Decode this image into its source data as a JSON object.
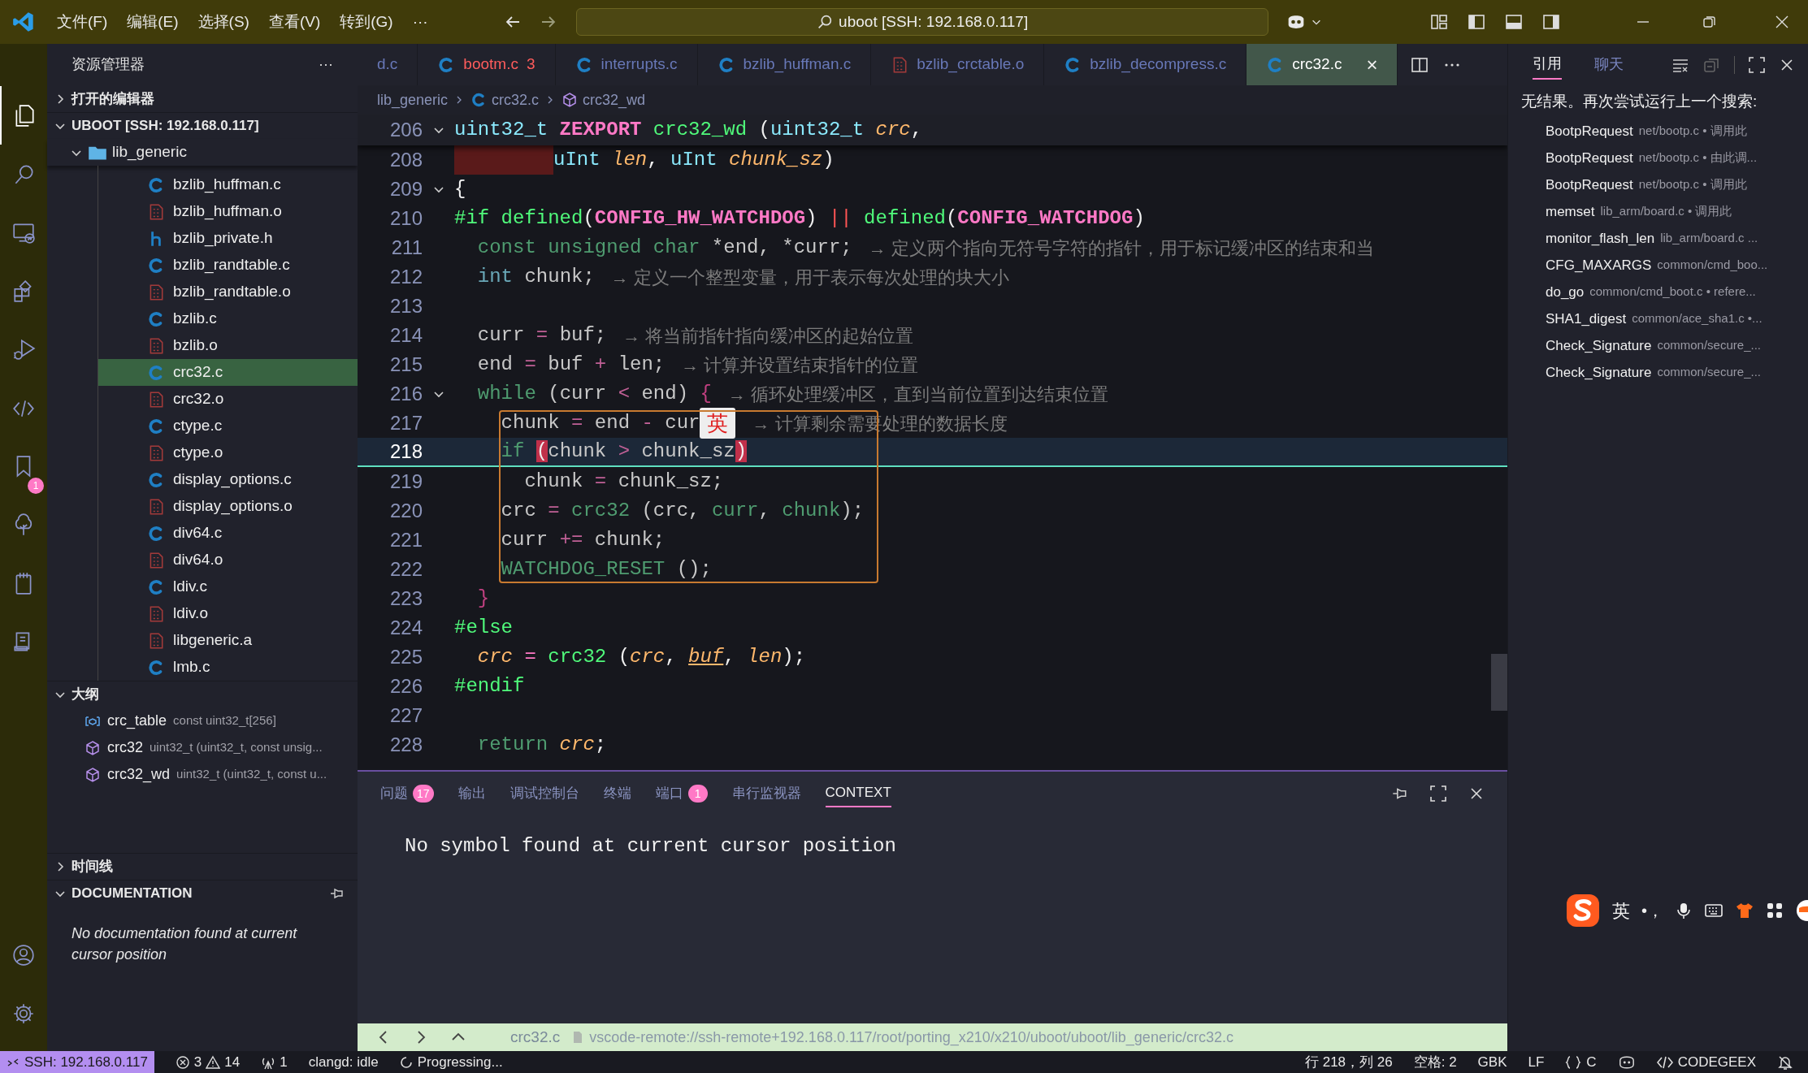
{
  "title_bar": {
    "menus": [
      "文件(F)",
      "编辑(E)",
      "选择(S)",
      "查看(V)",
      "转到(G)",
      "···"
    ],
    "search": "uboot [SSH: 192.168.0.117]"
  },
  "activity_bar": {
    "top": [
      {
        "kind": "files",
        "selected": true
      },
      {
        "kind": "search",
        "selected": false
      },
      {
        "kind": "remote",
        "selected": false
      },
      {
        "kind": "extensions",
        "selected": false
      },
      {
        "kind": "debug",
        "selected": false
      },
      {
        "kind": "code",
        "selected": false
      },
      {
        "kind": "bookmark",
        "selected": false,
        "badge": "1"
      },
      {
        "kind": "tree",
        "selected": false
      },
      {
        "kind": "notebook",
        "selected": false
      },
      {
        "kind": "document",
        "selected": false
      }
    ],
    "bottom": [
      {
        "kind": "account",
        "selected": false
      },
      {
        "kind": "gear",
        "selected": false
      }
    ]
  },
  "sidebar": {
    "title": "资源管理器",
    "more": "···",
    "open_editors": {
      "label": "打开的编辑器",
      "expanded": false
    },
    "workspace": {
      "label": "UBOOT [SSH: 192.168.0.117]",
      "expanded": true,
      "tree": [
        {
          "label": "lib_generic",
          "kind": "folder",
          "expanded": true,
          "children": [
            {
              "label": "bzlib_huffman.c",
              "kind": "c",
              "selected": false
            },
            {
              "label": "bzlib_huffman.o",
              "kind": "o",
              "selected": false
            },
            {
              "label": "bzlib_private.h",
              "kind": "h",
              "selected": false
            },
            {
              "label": "bzlib_randtable.c",
              "kind": "c",
              "selected": false
            },
            {
              "label": "bzlib_randtable.o",
              "kind": "o",
              "selected": false
            },
            {
              "label": "bzlib.c",
              "kind": "c",
              "selected": false
            },
            {
              "label": "bzlib.o",
              "kind": "o",
              "selected": false
            },
            {
              "label": "crc32.c",
              "kind": "c",
              "selected": true
            },
            {
              "label": "crc32.o",
              "kind": "o",
              "selected": false
            },
            {
              "label": "ctype.c",
              "kind": "c",
              "selected": false
            },
            {
              "label": "ctype.o",
              "kind": "o",
              "selected": false
            },
            {
              "label": "display_options.c",
              "kind": "c",
              "selected": false
            },
            {
              "label": "display_options.o",
              "kind": "o",
              "selected": false
            },
            {
              "label": "div64.c",
              "kind": "c",
              "selected": false
            },
            {
              "label": "div64.o",
              "kind": "o",
              "selected": false
            },
            {
              "label": "ldiv.c",
              "kind": "c",
              "selected": false
            },
            {
              "label": "ldiv.o",
              "kind": "o",
              "selected": false
            },
            {
              "label": "libgeneric.a",
              "kind": "o",
              "selected": false
            },
            {
              "label": "lmb.c",
              "kind": "c",
              "selected": false
            }
          ]
        }
      ]
    },
    "outline": {
      "label": "大纲",
      "expanded": true,
      "items": [
        {
          "name": "crc_table",
          "detail": "const uint32_t[256]",
          "kind": "variable"
        },
        {
          "name": "crc32",
          "detail": "uint32_t (uint32_t, const unsig...",
          "kind": "function"
        },
        {
          "name": "crc32_wd",
          "detail": "uint32_t (uint32_t, const u...",
          "kind": "function"
        }
      ]
    },
    "timeline": {
      "label": "时间线",
      "expanded": false
    },
    "documentation": {
      "label": "DOCUMENTATION",
      "expanded": true,
      "text": "No documentation found at current cursor position"
    }
  },
  "tabs": [
    {
      "label": "d.c",
      "kind": "none",
      "error": false,
      "selected": false
    },
    {
      "label": "bootm.c",
      "kind": "c",
      "error": true,
      "problems": "3",
      "selected": false
    },
    {
      "label": "interrupts.c",
      "kind": "c",
      "error": false,
      "selected": false
    },
    {
      "label": "bzlib_huffman.c",
      "kind": "c",
      "error": false,
      "selected": false
    },
    {
      "label": "bzlib_crctable.o",
      "kind": "o",
      "error": false,
      "selected": false
    },
    {
      "label": "bzlib_decompress.c",
      "kind": "c",
      "error": false,
      "selected": false
    },
    {
      "label": "crc32.c",
      "kind": "c",
      "error": false,
      "selected": true,
      "close": "×"
    }
  ],
  "editor": {
    "breadcrumb": [
      {
        "label": "lib_generic"
      },
      {
        "label": "crc32.c",
        "kind": "c"
      },
      {
        "label": "crc32_wd",
        "kind": "function"
      }
    ],
    "sticky": {
      "number": "206",
      "fold": true,
      "current": false,
      "error_indent": false,
      "tokens": [
        {
          "text": "uint32_t",
          "kind": "type"
        },
        {
          "text": " ZEXPORT",
          "kind": "macro"
        },
        {
          "text": " crc32_wd",
          "kind": "func"
        },
        {
          "text": " (",
          "kind": "plain"
        },
        {
          "text": "uint32_t",
          "kind": "type"
        },
        {
          "text": " crc",
          "kind": "param"
        },
        {
          "text": ",",
          "kind": "plain"
        }
      ]
    },
    "lines": [
      {
        "number": "208",
        "fold": false,
        "current": false,
        "error_indent": true,
        "tokens": [
          {
            "text": "uInt",
            "kind": "type"
          },
          {
            "text": " len",
            "kind": "param"
          },
          {
            "text": ",",
            "kind": "plain"
          },
          {
            "text": " uInt",
            "kind": "type"
          },
          {
            "text": " chunk_sz",
            "kind": "param"
          },
          {
            "text": ")",
            "kind": "plain"
          }
        ]
      },
      {
        "number": "209",
        "fold": true,
        "current": false,
        "error_indent": false,
        "tokens": [
          {
            "text": "{",
            "kind": "plain"
          }
        ]
      },
      {
        "number": "210",
        "fold": false,
        "current": false,
        "error_indent": false,
        "tokens": [
          {
            "text": "#if defined",
            "kind": "preproc"
          },
          {
            "text": "(",
            "kind": "plain"
          },
          {
            "text": "CONFIG_HW_WATCHDOG",
            "kind": "macro"
          },
          {
            "text": ") ",
            "kind": "plain"
          },
          {
            "text": "||",
            "kind": "op"
          },
          {
            "text": " defined",
            "kind": "preproc"
          },
          {
            "text": "(",
            "kind": "plain"
          },
          {
            "text": "CONFIG_WATCHDOG",
            "kind": "macro"
          },
          {
            "text": ")",
            "kind": "plain"
          }
        ]
      },
      {
        "number": "211",
        "fold": false,
        "current": false,
        "error_indent": false,
        "tokens": [
          {
            "text": "  const unsigned char",
            "kind": "kw"
          },
          {
            "text": " *end, *curr;",
            "kind": "dim"
          }
        ],
        "hint": "→ 定义两个指向无符号字符的指针，用于标记缓冲区的结束和当"
      },
      {
        "number": "212",
        "fold": false,
        "current": false,
        "error_indent": false,
        "tokens": [
          {
            "text": "  int",
            "kind": "dimtype"
          },
          {
            "text": " chunk;",
            "kind": "dim"
          }
        ],
        "hint": "→ 定义一个整型变量，用于表示每次处理的块大小"
      },
      {
        "number": "213",
        "fold": false,
        "current": false,
        "error_indent": false
      },
      {
        "number": "214",
        "fold": false,
        "current": false,
        "error_indent": false,
        "tokens": [
          {
            "text": "  curr ",
            "kind": "dim"
          },
          {
            "text": "=",
            "kind": "dimop"
          },
          {
            "text": " buf;",
            "kind": "dim"
          }
        ],
        "hint": "→ 将当前指针指向缓冲区的起始位置"
      },
      {
        "number": "215",
        "fold": false,
        "current": false,
        "error_indent": false,
        "tokens": [
          {
            "text": "  end ",
            "kind": "dim"
          },
          {
            "text": "=",
            "kind": "dimop"
          },
          {
            "text": " buf ",
            "kind": "dim"
          },
          {
            "text": "+",
            "kind": "dimop"
          },
          {
            "text": " len;",
            "kind": "dim"
          }
        ],
        "hint": "→ 计算并设置结束指针的位置"
      },
      {
        "number": "216",
        "fold": true,
        "current": false,
        "error_indent": false,
        "tokens": [
          {
            "text": "  while",
            "kind": "kw"
          },
          {
            "text": " (curr ",
            "kind": "dim"
          },
          {
            "text": "<",
            "kind": "dimop"
          },
          {
            "text": " end) ",
            "kind": "dim"
          },
          {
            "text": "{",
            "kind": "brace"
          }
        ],
        "hint": "→ 循环处理缓冲区，直到当前位置到达结束位置"
      },
      {
        "number": "217",
        "fold": false,
        "current": false,
        "error_indent": false,
        "tokens": [
          {
            "text": "    chunk ",
            "kind": "dim"
          },
          {
            "text": "=",
            "kind": "dimop"
          },
          {
            "text": " end ",
            "kind": "dim"
          },
          {
            "text": "-",
            "kind": "dimop"
          },
          {
            "text": " cur",
            "kind": "dim"
          }
        ],
        "ime": "英",
        "hint": "→ 计算剩余需要处理的数据长度"
      },
      {
        "number": "218",
        "fold": false,
        "current": true,
        "error_indent": false,
        "tokens": [
          {
            "text": "    if ",
            "kind": "kw"
          },
          {
            "text": "(",
            "kind": "match"
          },
          {
            "text": "chunk ",
            "kind": "dim"
          },
          {
            "text": ">",
            "kind": "dimop"
          },
          {
            "text": " chunk_sz",
            "kind": "dim"
          },
          {
            "text": ")",
            "kind": "match"
          }
        ]
      },
      {
        "number": "219",
        "fold": false,
        "current": false,
        "error_indent": false,
        "tokens": [
          {
            "text": "      chunk ",
            "kind": "dim"
          },
          {
            "text": "=",
            "kind": "dimop"
          },
          {
            "text": " chunk_sz;",
            "kind": "dim"
          }
        ]
      },
      {
        "number": "220",
        "fold": false,
        "current": false,
        "error_indent": false,
        "tokens": [
          {
            "text": "    crc ",
            "kind": "dim"
          },
          {
            "text": "=",
            "kind": "dimop"
          },
          {
            "text": " crc32",
            "kind": "dimfunc"
          },
          {
            "text": " (crc, ",
            "kind": "dim"
          },
          {
            "text": "curr",
            "kind": "dimfunc"
          },
          {
            "text": ", ",
            "kind": "dim"
          },
          {
            "text": "chunk",
            "kind": "dimfunc"
          },
          {
            "text": ");",
            "kind": "dim"
          }
        ]
      },
      {
        "number": "221",
        "fold": false,
        "current": false,
        "error_indent": false,
        "tokens": [
          {
            "text": "    curr ",
            "kind": "dim"
          },
          {
            "text": "+=",
            "kind": "dimop"
          },
          {
            "text": " chunk;",
            "kind": "dim"
          }
        ]
      },
      {
        "number": "222",
        "fold": false,
        "current": false,
        "error_indent": false,
        "tokens": [
          {
            "text": "    WATCHDOG_RESET",
            "kind": "dimfunc"
          },
          {
            "text": " ();",
            "kind": "dim"
          }
        ]
      },
      {
        "number": "223",
        "fold": false,
        "current": false,
        "error_indent": false,
        "tokens": [
          {
            "text": "  }",
            "kind": "brace"
          }
        ]
      },
      {
        "number": "224",
        "fold": false,
        "current": false,
        "error_indent": false,
        "tokens": [
          {
            "text": "#else",
            "kind": "preproc"
          }
        ]
      },
      {
        "number": "225",
        "fold": false,
        "current": false,
        "error_indent": false,
        "tokens": [
          {
            "text": "  crc",
            "kind": "param"
          },
          {
            "text": " =",
            "kind": "op2"
          },
          {
            "text": " crc32",
            "kind": "func"
          },
          {
            "text": " (",
            "kind": "plain"
          },
          {
            "text": "crc",
            "kind": "param"
          },
          {
            "text": ", ",
            "kind": "plain"
          },
          {
            "text": "buf",
            "kind": "paramu"
          },
          {
            "text": ", ",
            "kind": "plain"
          },
          {
            "text": "len",
            "kind": "param"
          },
          {
            "text": ");",
            "kind": "plain"
          }
        ]
      },
      {
        "number": "226",
        "fold": false,
        "current": false,
        "error_indent": false,
        "tokens": [
          {
            "text": "#endif",
            "kind": "preproc"
          }
        ]
      },
      {
        "number": "227",
        "fold": false,
        "current": false,
        "error_indent": false
      },
      {
        "number": "228",
        "fold": false,
        "current": false,
        "error_indent": false,
        "tokens": [
          {
            "text": "  return",
            "kind": "kw"
          },
          {
            "text": " crc",
            "kind": "param"
          },
          {
            "text": ";",
            "kind": "plain"
          }
        ]
      }
    ]
  },
  "panel": {
    "tabs": [
      {
        "label": "问题",
        "badge": "17",
        "selected": false
      },
      {
        "label": "输出",
        "selected": false
      },
      {
        "label": "调试控制台",
        "selected": false
      },
      {
        "label": "终端",
        "selected": false
      },
      {
        "label": "端口",
        "badge": "1",
        "selected": false
      },
      {
        "label": "串行监视器",
        "selected": false
      },
      {
        "label": "CONTEXT",
        "selected": true
      }
    ],
    "content": "No symbol found at current cursor position",
    "footer": {
      "file": "crc32.c",
      "path": "vscode-remote://ssh-remote+192.168.0.117/root/porting_x210/x210/uboot/uboot/lib_generic/crc32.c"
    }
  },
  "references": {
    "tabs": [
      {
        "label": "引用",
        "selected": true
      },
      {
        "label": "聊天",
        "selected": false
      }
    ],
    "message": "无结果。再次尝试运行上一个搜索:",
    "items": [
      {
        "name": "BootpRequest",
        "detail": "net/bootp.c • 调用此"
      },
      {
        "name": "BootpRequest",
        "detail": "net/bootp.c • 由此调..."
      },
      {
        "name": "BootpRequest",
        "detail": "net/bootp.c • 调用此"
      },
      {
        "name": "memset",
        "detail": "lib_arm/board.c • 调用此"
      },
      {
        "name": "monitor_flash_len",
        "detail": "lib_arm/board.c ..."
      },
      {
        "name": "CFG_MAXARGS",
        "detail": "common/cmd_boo..."
      },
      {
        "name": "do_go",
        "detail": "common/cmd_boot.c • refere..."
      },
      {
        "name": "SHA1_digest",
        "detail": "common/ace_sha1.c •..."
      },
      {
        "name": "Check_Signature",
        "detail": "common/secure_..."
      },
      {
        "name": "Check_Signature",
        "detail": "common/secure_..."
      }
    ]
  },
  "ime_toolbar": {
    "mode": "英",
    "punct": "•，"
  },
  "status_bar": {
    "left": [
      {
        "kind": "remote",
        "text": "SSH: 192.168.0.117"
      },
      {
        "kind": "problems",
        "errors": "3",
        "warnings": "14"
      },
      {
        "kind": "ports",
        "text": "1"
      },
      {
        "kind": "text",
        "text": "clangd: idle"
      },
      {
        "kind": "progress",
        "text": "Progressing..."
      }
    ],
    "right": [
      {
        "kind": "text",
        "text": "行 218，列 26"
      },
      {
        "kind": "text",
        "text": "空格: 2"
      },
      {
        "kind": "text",
        "text": "GBK"
      },
      {
        "kind": "text",
        "text": "LF"
      },
      {
        "kind": "language",
        "text": "C"
      },
      {
        "kind": "copilot"
      },
      {
        "kind": "codegeex",
        "text": "CODEGEEX"
      },
      {
        "kind": "notify"
      }
    ]
  }
}
